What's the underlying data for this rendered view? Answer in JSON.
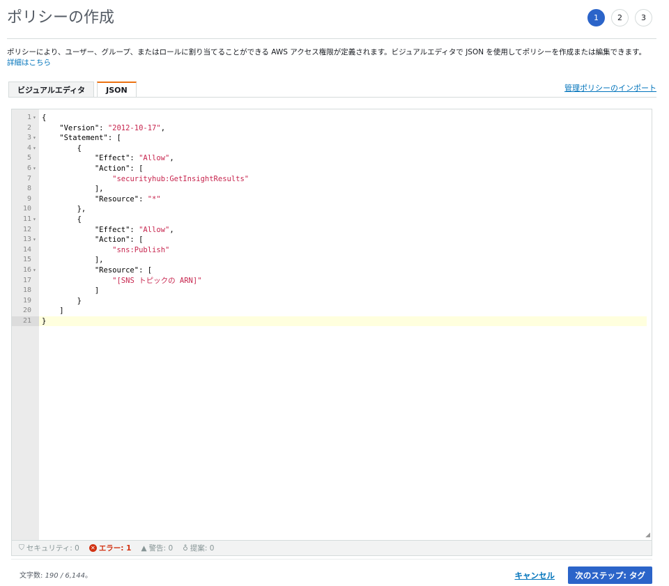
{
  "page": {
    "title": "ポリシーの作成",
    "steps": [
      "1",
      "2",
      "3"
    ],
    "description": "ポリシーにより、ユーザー、グループ、またはロールに割り当てることができる AWS アクセス権限が定義されます。ビジュアルエディタで JSON を使用してポリシーを作成または編集できます。",
    "learn_more": "詳細はこちら"
  },
  "tabs": [
    {
      "label": "ビジュアルエディタ",
      "active": false
    },
    {
      "label": "JSON",
      "active": true
    }
  ],
  "import_link": "管理ポリシーのインポート",
  "editor": {
    "lines": [
      {
        "n": "1",
        "fold": true,
        "text": "{"
      },
      {
        "n": "2",
        "fold": false,
        "text": "    \"Version\": \"2012-10-17\","
      },
      {
        "n": "3",
        "fold": true,
        "text": "    \"Statement\": ["
      },
      {
        "n": "4",
        "fold": true,
        "text": "        {"
      },
      {
        "n": "5",
        "fold": false,
        "text": "            \"Effect\": \"Allow\","
      },
      {
        "n": "6",
        "fold": true,
        "text": "            \"Action\": ["
      },
      {
        "n": "7",
        "fold": false,
        "text": "                \"securityhub:GetInsightResults\""
      },
      {
        "n": "8",
        "fold": false,
        "text": "            ],"
      },
      {
        "n": "9",
        "fold": false,
        "text": "            \"Resource\": \"*\""
      },
      {
        "n": "10",
        "fold": false,
        "text": "        },"
      },
      {
        "n": "11",
        "fold": true,
        "text": "        {"
      },
      {
        "n": "12",
        "fold": false,
        "text": "            \"Effect\": \"Allow\","
      },
      {
        "n": "13",
        "fold": true,
        "text": "            \"Action\": ["
      },
      {
        "n": "14",
        "fold": false,
        "text": "                \"sns:Publish\""
      },
      {
        "n": "15",
        "fold": false,
        "text": "            ],"
      },
      {
        "n": "16",
        "fold": true,
        "text": "            \"Resource\": ["
      },
      {
        "n": "17",
        "fold": false,
        "text": "                \"[SNS トピックの ARN]\""
      },
      {
        "n": "18",
        "fold": false,
        "text": "            ]"
      },
      {
        "n": "19",
        "fold": false,
        "text": "        }"
      },
      {
        "n": "20",
        "fold": false,
        "text": "    ]"
      },
      {
        "n": "21",
        "fold": false,
        "text": "}"
      }
    ],
    "current_line": 21
  },
  "status": {
    "security": "セキュリティ: 0",
    "errors": "エラー: 1",
    "warnings": "警告: 0",
    "suggestions": "提案: 0"
  },
  "footer": {
    "char_count_label": "文字数: ",
    "char_count_value": "190 / 6,144",
    "char_count_suffix": "。",
    "cancel": "キャンセル",
    "next": "次のステップ: タグ"
  },
  "colors": {
    "accent": "#2b64c9",
    "link": "#0073bb",
    "error": "#d13212",
    "string": "#c7254e",
    "tab_active_border": "#ec7211"
  },
  "icons": {
    "security": "shield-icon",
    "errors": "error-circle-icon",
    "warnings": "warning-triangle-icon",
    "suggestions": "lightbulb-icon"
  }
}
